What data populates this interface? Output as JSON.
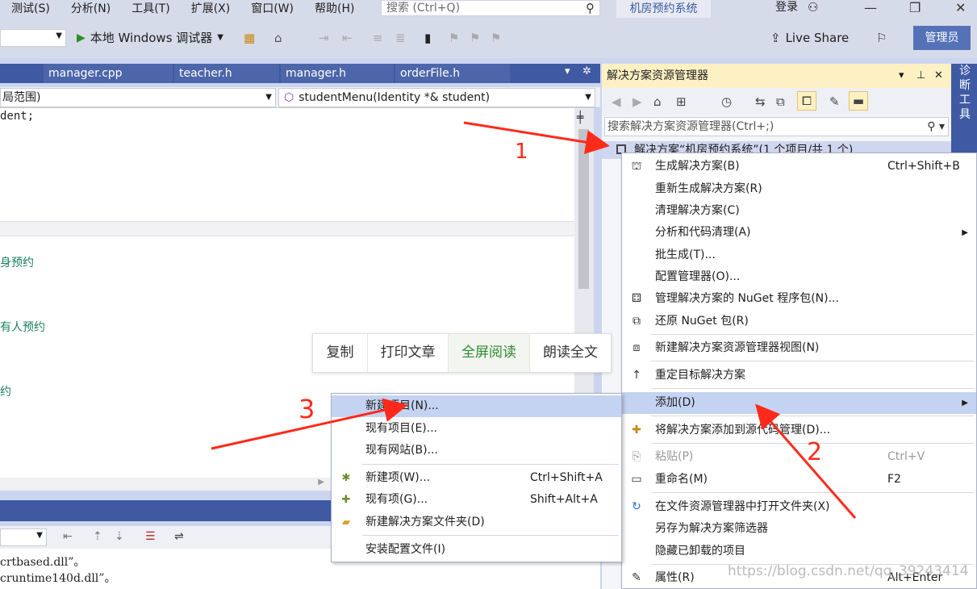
{
  "menubar": {
    "items": [
      "测试(S)",
      "分析(N)",
      "工具(T)",
      "扩展(X)",
      "窗口(W)",
      "帮助(H)"
    ],
    "search_placeholder": "搜索 (Ctrl+Q)",
    "app_title": "机房预约系统",
    "login_label": "登录"
  },
  "toolbar": {
    "run_label": "本地 Windows 调试器",
    "live_share_label": "Live Share",
    "admin_label": "管理员"
  },
  "editor": {
    "tabs": [
      "manager.cpp",
      "teacher.h",
      "manager.h",
      "orderFile.h"
    ],
    "scope_combo": "局范围)",
    "member_combo": "studentMenu(Identity *& student)",
    "code_lines": [
      "dent;",
      "身预约",
      "有人预约",
      "约"
    ]
  },
  "output": {
    "lines": [
      "crtbased.dll”。",
      "cruntime140d.dll”。"
    ]
  },
  "solution_explorer": {
    "title": "解决方案资源管理器",
    "search_placeholder": "搜索解决方案资源管理器(Ctrl+;)",
    "root_label": "解决方案“机房预约系统”(1 个项目/共 1 个)",
    "side_tab": "诊断工具"
  },
  "context_menu": {
    "items": [
      {
        "label": "生成解决方案(B)",
        "shortcut": "Ctrl+Shift+B",
        "icon": "build-icon"
      },
      {
        "label": "重新生成解决方案(R)",
        "shortcut": "",
        "icon": ""
      },
      {
        "label": "清理解决方案(C)",
        "shortcut": "",
        "icon": ""
      },
      {
        "label": "分析和代码清理(A)",
        "shortcut": "",
        "icon": ""
      },
      {
        "label": "批生成(T)...",
        "shortcut": "",
        "icon": ""
      },
      {
        "label": "配置管理器(O)...",
        "shortcut": "",
        "icon": ""
      },
      {
        "label": "管理解决方案的 NuGet 程序包(N)...",
        "shortcut": "",
        "icon": "nuget-icon"
      },
      {
        "label": "还原 NuGet 包(R)",
        "shortcut": "",
        "icon": "restore-icon"
      },
      {
        "label": "新建解决方案资源管理器视图(N)",
        "shortcut": "",
        "icon": "new-view-icon"
      },
      {
        "label": "重定目标解决方案",
        "shortcut": "",
        "icon": "retarget-icon"
      },
      {
        "label": "添加(D)",
        "shortcut": "",
        "icon": ""
      },
      {
        "label": "将解决方案添加到源代码管理(D)...",
        "shortcut": "",
        "icon": "source-control-icon"
      },
      {
        "label": "粘贴(P)",
        "shortcut": "Ctrl+V",
        "icon": "paste-icon"
      },
      {
        "label": "重命名(M)",
        "shortcut": "F2",
        "icon": "rename-icon"
      },
      {
        "label": "在文件资源管理器中打开文件夹(X)",
        "shortcut": "",
        "icon": "open-folder-icon"
      },
      {
        "label": "另存为解决方案筛选器",
        "shortcut": "",
        "icon": ""
      },
      {
        "label": "隐藏已卸载的项目",
        "shortcut": "",
        "icon": ""
      },
      {
        "label": "属性(R)",
        "shortcut": "Alt+Enter",
        "icon": "wrench-icon"
      }
    ]
  },
  "add_submenu": {
    "items": [
      {
        "label": "新建项目(N)...",
        "shortcut": ""
      },
      {
        "label": "现有项目(E)...",
        "shortcut": ""
      },
      {
        "label": "现有网站(B)...",
        "shortcut": ""
      },
      {
        "label": "新建项(W)...",
        "shortcut": "Ctrl+Shift+A"
      },
      {
        "label": "现有项(G)...",
        "shortcut": "Shift+Alt+A"
      },
      {
        "label": "新建解决方案文件夹(D)",
        "shortcut": ""
      },
      {
        "label": "安装配置文件(I)",
        "shortcut": ""
      }
    ]
  },
  "float_toolbar": {
    "copy": "复制",
    "print": "打印文章",
    "fullscreen": "全屏阅读",
    "read_aloud": "朗读全文"
  },
  "annotations": {
    "step1": "1",
    "step2": "2",
    "step3": "3",
    "arrow_color": "#ff2a1a"
  },
  "watermark": "https://blog.csdn.net/qq_39243414"
}
